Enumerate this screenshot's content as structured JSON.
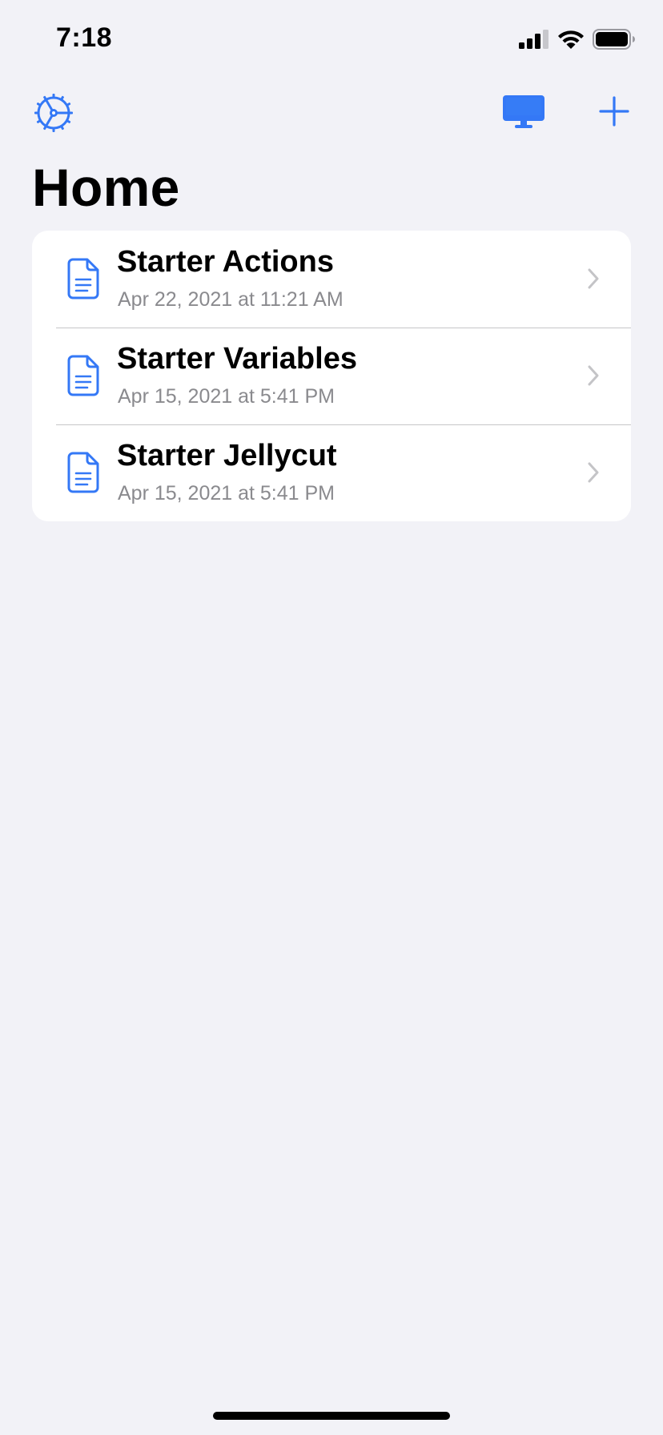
{
  "status_bar": {
    "time": "7:18",
    "icons": [
      "cellular-signal-icon",
      "wifi-icon",
      "battery-icon"
    ]
  },
  "nav": {
    "left_icon": "settings-gear-icon",
    "right_icons": [
      "desktop-display-icon",
      "plus-icon"
    ]
  },
  "page": {
    "title": "Home"
  },
  "items": [
    {
      "title": "Starter Actions",
      "subtitle": "Apr 22, 2021 at 11:21 AM",
      "icon": "document-icon"
    },
    {
      "title": "Starter Variables",
      "subtitle": "Apr 15, 2021 at 5:41 PM",
      "icon": "document-icon"
    },
    {
      "title": "Starter Jellycut",
      "subtitle": "Apr 15, 2021 at 5:41 PM",
      "icon": "document-icon"
    }
  ],
  "colors": {
    "accent": "#3478F6",
    "background": "#F2F2F7",
    "card": "#FFFFFF",
    "secondary_text": "#8A8A8E",
    "separator": "#C6C6C8",
    "chevron": "#C4C4C7"
  }
}
